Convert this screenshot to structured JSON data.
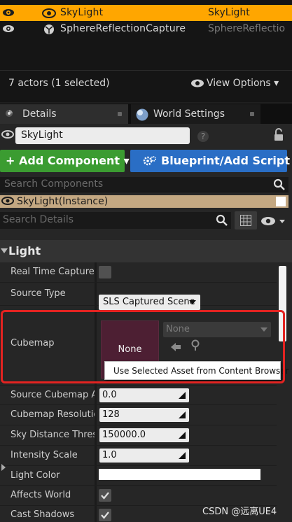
{
  "outliner": {
    "rows": [
      {
        "name": "SkyLight",
        "type": "SkyLight",
        "selected": true
      },
      {
        "name": "SphereReflectionCapture",
        "type": "SphereReflectio",
        "selected": false
      }
    ],
    "actor_count": "7 actors (1 selected)",
    "view_options": "View Options"
  },
  "tabs": {
    "details": "Details",
    "world_settings": "World Settings"
  },
  "details": {
    "actor_name": "SkyLight",
    "add_component": "Add Component",
    "blueprint": "Blueprint/Add Script",
    "search_components_placeholder": "Search Components",
    "instance_label": "SkyLight(Instance)",
    "search_details_placeholder": "Search Details"
  },
  "light": {
    "category": "Light",
    "real_time_capture": {
      "label": "Real Time Capture",
      "checked": false
    },
    "source_type": {
      "label": "Source Type",
      "value": "SLS Captured Scene"
    },
    "cubemap": {
      "label": "Cubemap",
      "thumb_text": "None",
      "combo_value": "None",
      "tooltip": "Use Selected Asset from Content Browser"
    },
    "source_cubemap_angle": {
      "label": "Source Cubemap Angle",
      "value": "0.0"
    },
    "cubemap_resolution": {
      "label": "Cubemap Resolution",
      "value": "128"
    },
    "sky_distance_threshold": {
      "label": "Sky Distance Threshold",
      "value": "150000.0"
    },
    "intensity_scale": {
      "label": "Intensity Scale",
      "value": "1.0"
    },
    "light_color": {
      "label": "Light Color",
      "color": "#ffffff"
    },
    "affects_world": {
      "label": "Affects World",
      "checked": true
    },
    "cast_shadows": {
      "label": "Cast Shadows",
      "checked": true
    }
  },
  "watermark": "CSDN @远离UE4",
  "colors": {
    "selection": "#ffa600",
    "add_component": "#3b9c31",
    "blueprint": "#2a6ec5",
    "highlight": "#e32321",
    "cubemap_thumb": "#4d1f33"
  },
  "icons": [
    "eye-icon",
    "skylight-icon",
    "sphere-capture-icon",
    "world-icon",
    "help-icon",
    "lock-icon",
    "gear-icon",
    "search-icon",
    "grid-icon",
    "arrow-left-icon",
    "browse-icon",
    "checkmark-icon"
  ]
}
